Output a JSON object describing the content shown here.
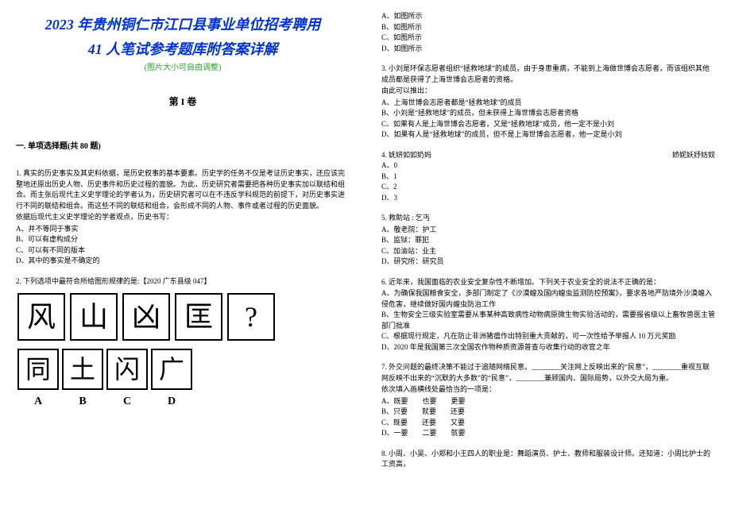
{
  "header": {
    "title_line1": "2023 年贵州铜仁市江口县事业单位招考聘用",
    "title_line2": "41 人笔试参考题库附答案详解",
    "note": "(图片大小可自由调整)",
    "juan": "第 I 卷"
  },
  "section1_head": "一. 单项选择题(共 80 题)",
  "q1": {
    "stem": "1. 真实的历史事实及其史料依据，是历史叙事的基本要素。历史学的任务不仅是考证历史事实，还应该完整地还原出历史人物、历史事件和历史过程的面貌。为此，历史研究者需要把各种历史事实加以联结和组合。而主张后现代主义史学理论的学者认为，历史研究者可以在不违反学科规范的前提下，对历史事实进行不同的联结和组合。而这些不同的联结和组合，会形成不同的人物、事件或者过程的历史面貌。",
    "lead": "依据后现代主义史学理论的学者观点，历史书写：",
    "A": "A、并不等同于事实",
    "B": "B、可以有虚构成分",
    "C": "C、可以有不同的版本",
    "D": "D、其中的事实是不确定的"
  },
  "q2": {
    "stem": "2. 下列选项中最符合所给图形规律的是:【2020 广东县级 047】",
    "row1": [
      "风",
      "山",
      "凶",
      "匡",
      "?"
    ],
    "row2": [
      "同",
      "土",
      "闪",
      "广"
    ],
    "labels": [
      "A",
      "B",
      "C",
      "D"
    ]
  },
  "top_right_opts": {
    "A": "A、如图所示",
    "B": "B、如图所示",
    "C": "C、如图所示",
    "D": "D、如图所示"
  },
  "q3": {
    "stem": "3. 小刘是环保志愿者组织“拯救地球”的成员，由于身患重病，不能到上海做世博会志愿者，而该组织其他成员都是获得了上海世博会志愿者的资格。",
    "lead": "由此可以推出：",
    "A": "A、上海世博会志愿者都是“拯救地球”的成员",
    "B": "B、小刘是“拯救地球”的成员，但未获得上海世博会志愿者资格",
    "C": "C、如果有人是上海世博会志愿者，又是“拯救地球”成员，他一定不是小刘",
    "D": "D、如果有人是“拯救地球”的成员，但不是上海世博会志愿者，他一定是小刘"
  },
  "q4": {
    "left": "4. 妩妍如如奶妈",
    "right": "娇妮妖妤妨奴",
    "A": "A、0",
    "B": "B、1",
    "C": "C、2",
    "D": "D、3"
  },
  "q5": {
    "stem": "5. 救助站 : 乞丐",
    "A": "A、敬老院：护工",
    "B": "B、监狱：罪犯",
    "C": "C、加油站：业主",
    "D": "D、研究所：研究员"
  },
  "q6": {
    "stem": "6. 近年来，我国面临的农业安全复杂性不断增加。下列关于农业安全的说法不正确的是：",
    "A": "A、为确保我国粮食安全，多部门制定了《沙漠蝗及国内蝗虫监测防控预案》，要求各地严防境外沙漠蝗入侵危害，继续做好国内蝗虫防治工作",
    "B": "B、生物安全三级实验室需要从事某种高致病性动物病原微生物实验活动的，需要报省级以上畜牧兽医主管部门批准",
    "C": "C、根据现行规定，凡在防止非洲猪瘟作出特别重大贡献的，可一次性给予举报人 10 万元奖励",
    "D": "D、2020 年是我国第三次全国农作物种质资源普查与收集行动的收官之年"
  },
  "q7": {
    "stem": "7. 外交问题的最终决策不能过于追随网络民意。________关注网上反映出来的“民意”，________重视互联网反映不出来的“沉默的大多数”的“民意”，________兼顾国内、国际局势，以外交大局为重。",
    "lead": "依次填入画横线处最恰当的一项是：",
    "A": "A、既要　　也要　　更要",
    "B": "B、只要　　就要　　还要",
    "C": "C、既要　　还要　　又要",
    "D": "D、一要　　二要　　就要"
  },
  "q8": {
    "stem": "8. 小周、小吴、小郑和小王四人的职业是：舞蹈演员、护士、教师和服装设计师。还知道：小周比护士的工资高，"
  }
}
